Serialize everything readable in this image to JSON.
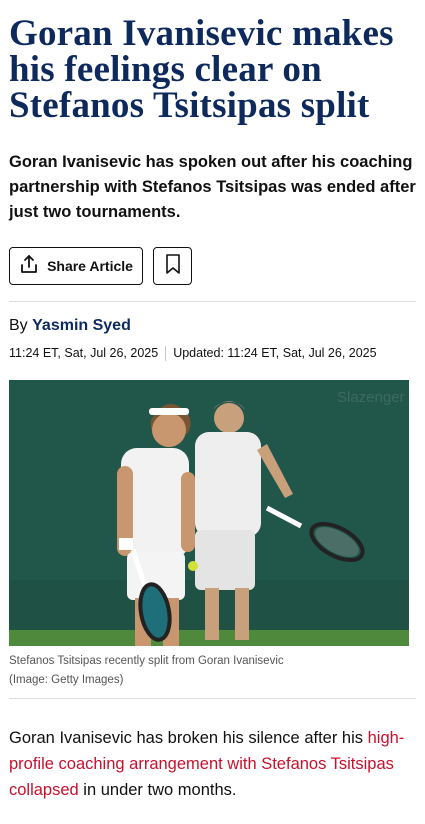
{
  "article": {
    "headline": "Goran Ivanisevic makes his feelings clear on Stefanos Tsitsipas split",
    "standfirst": "Goran Ivanisevic has spoken out after his coaching partnership with Stefanos Tsitsipas was ended after just two tournaments.",
    "share_label": "Share Article",
    "byline_prefix": "By",
    "author": "Yasmin Syed",
    "published": "11:24 ET, Sat, Jul 26, 2025",
    "updated": "Updated: 11:24 ET, Sat, Jul 26, 2025",
    "image": {
      "watermark": "Slazenger",
      "caption": "Stefanos Tsitsipas recently split from Goran Ivanisevic",
      "credit": "(Image: Getty Images)"
    },
    "body": {
      "intro_text": "Goran Ivanisevic has broken his silence after his",
      "link_text": "high-profile coaching arrangement with Stefanos Tsitsipas collapsed",
      "outro_text": " in under two months."
    }
  },
  "icons": {
    "share": "share-icon",
    "bookmark": "bookmark-icon"
  },
  "colors": {
    "headline": "#0e2a5c",
    "link": "#c8102e",
    "court": "#1f5244"
  }
}
